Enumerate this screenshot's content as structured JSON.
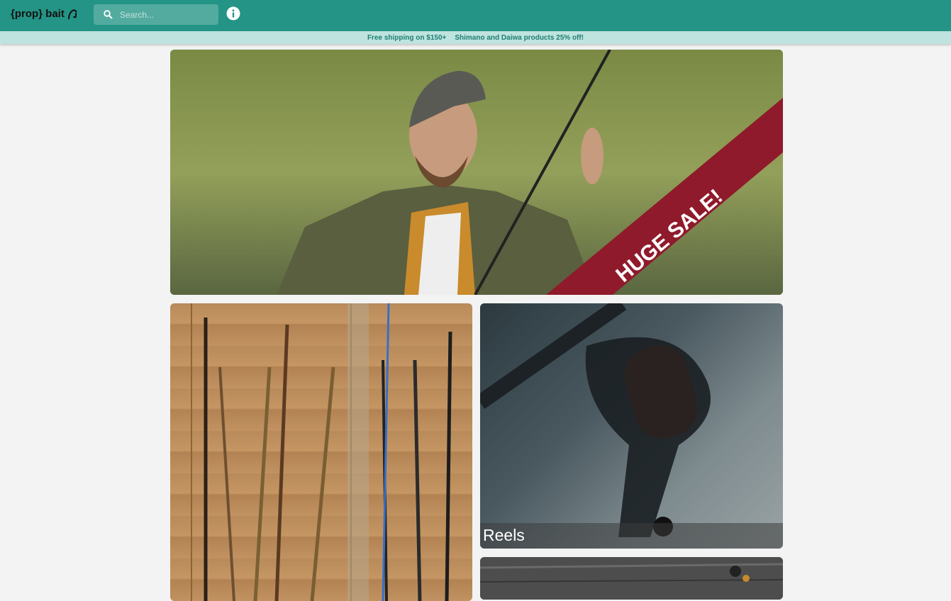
{
  "header": {
    "logo_text": "{prop} bait",
    "search_placeholder": "Search...",
    "info_icon": "info-icon"
  },
  "promo": {
    "shipping": "Free shipping on $150+",
    "discount": "Shimano and Daiwa products 25% off!"
  },
  "hero": {
    "banner_text": "HUGE SALE!"
  },
  "categories": [
    {
      "label": "Reels"
    }
  ],
  "colors": {
    "primary": "#239485",
    "promo_bg": "#bfe3df",
    "banner": "#8f1a2b",
    "page_bg": "#f3f3f3"
  }
}
